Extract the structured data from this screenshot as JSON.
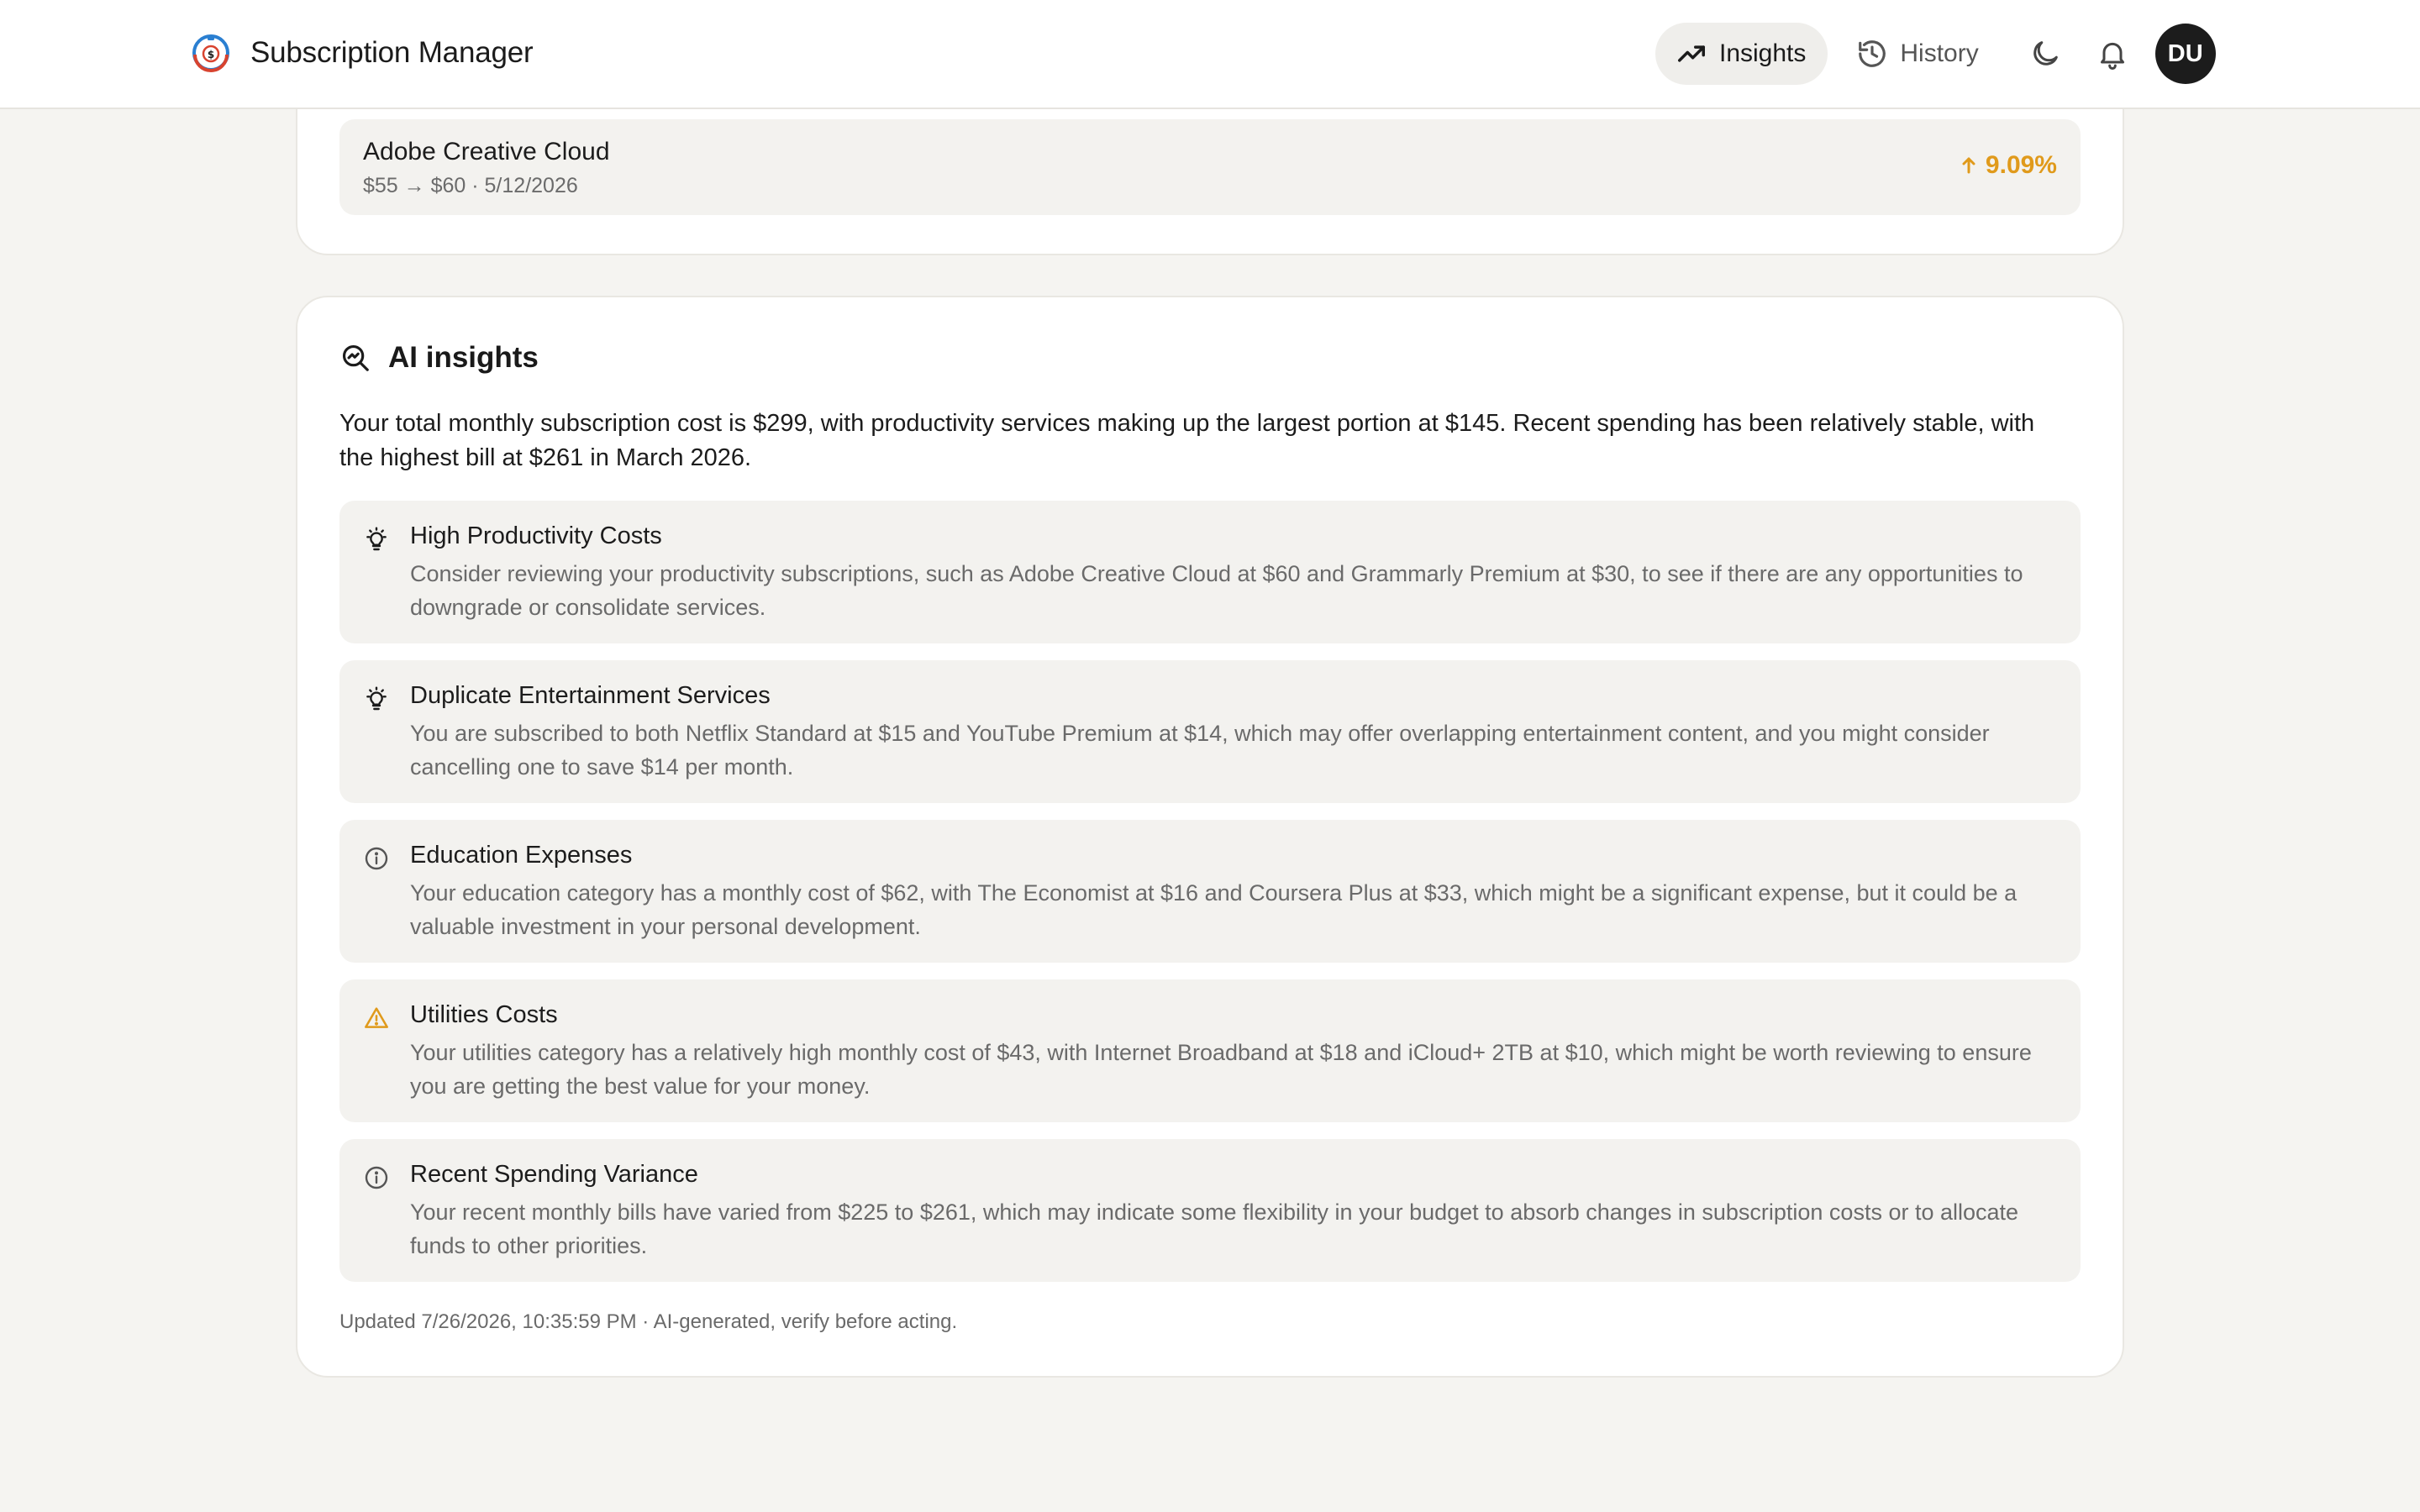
{
  "header": {
    "title": "Subscription Manager",
    "nav": [
      {
        "label": "Insights",
        "icon": "trending-up-icon",
        "active": true
      },
      {
        "label": "History",
        "icon": "history-icon",
        "active": false
      }
    ],
    "theme_icon": "moon-icon",
    "notifications_icon": "bell-icon",
    "avatar_initials": "DU"
  },
  "price_changes": {
    "items": [
      {
        "name": "Adobe Creative Cloud",
        "detail": "$55 → $60 · 5/12/2026",
        "change": "9.09%",
        "direction": "up"
      }
    ]
  },
  "ai_insights": {
    "title": "AI insights",
    "summary": "Your total monthly subscription cost is $299, with productivity services making up the largest portion at $145. Recent spending has been relatively stable, with the highest bill at $261 in March 2026.",
    "items": [
      {
        "icon": "lightbulb-icon",
        "title": "High Productivity Costs",
        "description": "Consider reviewing your productivity subscriptions, such as Adobe Creative Cloud at $60 and Grammarly Premium at $30, to see if there are any opportunities to downgrade or consolidate services."
      },
      {
        "icon": "lightbulb-icon",
        "title": "Duplicate Entertainment Services",
        "description": "You are subscribed to both Netflix Standard at $15 and YouTube Premium at $14, which may offer overlapping entertainment content, and you might consider cancelling one to save $14 per month."
      },
      {
        "icon": "info-icon",
        "title": "Education Expenses",
        "description": "Your education category has a monthly cost of $62, with The Economist at $16 and Coursera Plus at $33, which might be a significant expense, but it could be a valuable investment in your personal development."
      },
      {
        "icon": "warning-icon",
        "title": "Utilities Costs",
        "description": "Your utilities category has a relatively high monthly cost of $43, with Internet Broadband at $18 and iCloud+ 2TB at $10, which might be worth reviewing to ensure you are getting the best value for your money."
      },
      {
        "icon": "info-icon",
        "title": "Recent Spending Variance",
        "description": "Your recent monthly bills have varied from $225 to $261, which may indicate some flexibility in your budget to absorb changes in subscription costs or to allocate funds to other priorities."
      }
    ],
    "footer": "Updated 7/26/2026, 10:35:59 PM · AI-generated, verify before acting."
  },
  "colors": {
    "background": "#f5f4f1",
    "card": "#ffffff",
    "item_bg": "#f3f2ef",
    "accent_warning": "#e09a1b",
    "text_muted": "#6a6a6a"
  }
}
